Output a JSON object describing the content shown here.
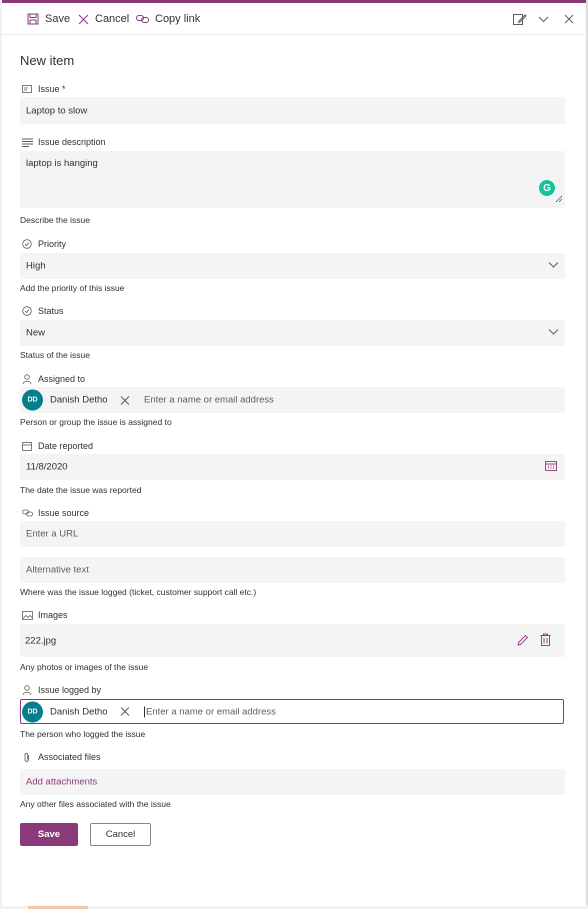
{
  "colors": {
    "accent": "#8a3a7a",
    "avatar": "#037f8c",
    "field_bg": "#f4f4f4",
    "grammarly": "#15c39a"
  },
  "command_bar": {
    "save": "Save",
    "cancel": "Cancel",
    "copy_link": "Copy link",
    "icons": [
      "save-icon",
      "cancel-icon",
      "copy-link-icon",
      "edit-form-icon",
      "chevron-down-icon",
      "close-icon"
    ]
  },
  "form": {
    "title": "New item",
    "issue": {
      "label": "Issue *",
      "value": "Laptop to slow"
    },
    "issue_description": {
      "label": "Issue description",
      "value": "laptop is hanging",
      "hint": "Describe the issue"
    },
    "priority": {
      "label": "Priority",
      "value": "High",
      "hint": "Add the priority of this issue"
    },
    "status": {
      "label": "Status",
      "value": "New",
      "hint": "Status of the issue"
    },
    "assigned_to": {
      "label": "Assigned to",
      "person_initials": "DD",
      "person_name": "Danish Detho",
      "placeholder": "Enter a name or email address",
      "hint": "Person or group the issue is assigned to"
    },
    "date_reported": {
      "label": "Date reported",
      "value": "11/8/2020",
      "hint": "The date the issue was reported"
    },
    "issue_source": {
      "label": "Issue source",
      "url_placeholder": "Enter a URL",
      "alt_placeholder": "Alternative text",
      "hint": "Where was the issue logged (ticket, customer support call etc.)"
    },
    "images": {
      "label": "Images",
      "value": "222.jpg",
      "hint": "Any photos or images of the issue"
    },
    "issue_logged_by": {
      "label": "Issue logged by",
      "person_initials": "DD",
      "person_name": "Danish Detho",
      "placeholder": "Enter a name or email address",
      "hint": "The person who logged the issue"
    },
    "associated_files": {
      "label": "Associated files",
      "link": "Add attachments",
      "hint": "Any other files associated with the issue"
    }
  },
  "footer": {
    "save": "Save",
    "cancel": "Cancel"
  }
}
